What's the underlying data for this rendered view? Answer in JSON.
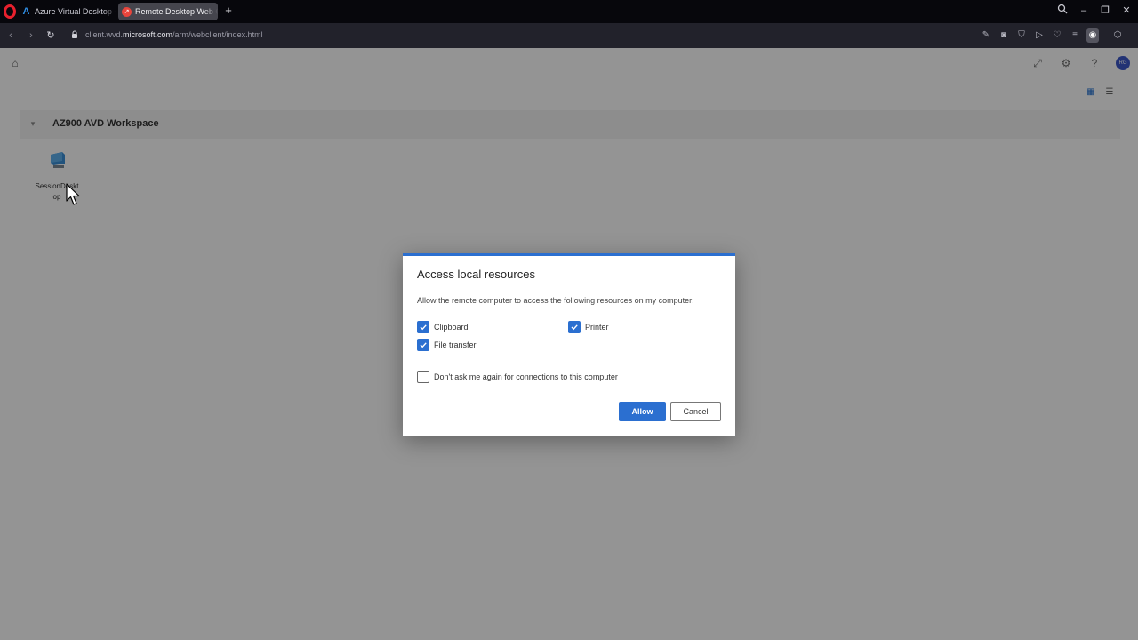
{
  "browser": {
    "tabs": [
      {
        "label": "Azure Virtual Desktop - M",
        "favicon": "azure-icon",
        "active": false
      },
      {
        "label": "Remote Desktop Web Cli",
        "favicon": "remote-desktop-icon",
        "active": true
      }
    ],
    "url": {
      "pre": "client.wvd.",
      "host": "microsoft.com",
      "path": "/arm/webclient/index.html"
    },
    "accent_color": "#6b3cf0"
  },
  "app": {
    "avatar_initials": "RG",
    "workspace": {
      "title": "AZ900 AVD Workspace",
      "resources": [
        {
          "label": "SessionDesktop",
          "icon": "desktop-icon"
        }
      ]
    }
  },
  "dialog": {
    "title": "Access local resources",
    "description": "Allow the remote computer to access the following resources on my computer:",
    "options": [
      {
        "label": "Clipboard",
        "checked": true
      },
      {
        "label": "Printer",
        "checked": true
      },
      {
        "label": "File transfer",
        "checked": true
      }
    ],
    "dont_ask": {
      "label": "Don't ask me again for connections to this computer",
      "checked": false
    },
    "allow_label": "Allow",
    "cancel_label": "Cancel",
    "accent_color": "#2b6fd0"
  }
}
